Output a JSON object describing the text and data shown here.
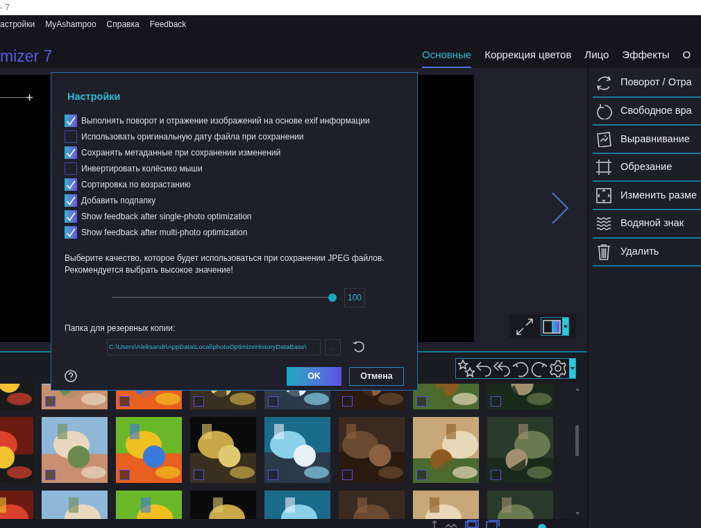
{
  "title_bar": {
    "title": "- 7"
  },
  "menu": [
    "астройки",
    "MyAshampoo",
    "Справка",
    "Feedback"
  ],
  "app_title": "mizer 7",
  "tabs": [
    {
      "label": "Основные",
      "selected": true
    },
    {
      "label": "Коррекция цветов",
      "selected": false
    },
    {
      "label": "Лицо",
      "selected": false
    },
    {
      "label": "Эффекты",
      "selected": false
    },
    {
      "label": "О",
      "selected": false
    }
  ],
  "tools": [
    {
      "kind": "rotate-flip",
      "label": "Поворот / Отра"
    },
    {
      "kind": "free-rotate",
      "label": "Свободное вра"
    },
    {
      "kind": "straighten",
      "label": "Выравнивание"
    },
    {
      "kind": "crop",
      "label": "Обрезание"
    },
    {
      "kind": "resize",
      "label": "Изменить разме"
    },
    {
      "kind": "watermark",
      "label": "Водяной знак"
    },
    {
      "kind": "delete",
      "label": "Удалить"
    }
  ],
  "dialog": {
    "title": "Настройки",
    "options": [
      {
        "label": "Выполнять поворот и отражение изображений на основе exif информации",
        "checked": true
      },
      {
        "label": "Использовать оригинальную дату файла при сохранении",
        "checked": false
      },
      {
        "label": "Сохранять метаданные при сохранении изменений",
        "checked": true
      },
      {
        "label": "Инвертировать колёсико мыши",
        "checked": false
      },
      {
        "label": "Сортировка по возрастанию",
        "checked": true
      },
      {
        "label": "Добавить подпапку",
        "checked": true
      },
      {
        "label": "Show feedback after single-photo optimization",
        "checked": true
      },
      {
        "label": "Show feedback after multi-photo optimization",
        "checked": true
      }
    ],
    "quality_note": [
      "Выберите качество, которое будет использоваться при сохранении JPEG файлов.",
      "Рекомендуется выбрать высокое значение!"
    ],
    "quality": {
      "level": 1,
      "value": "100"
    },
    "backup_label": "Папка для резервных копии:",
    "backup_path": "C:\\Users\\Aleksandr\\AppData\\Local\\photoOptimizeHistoryDataBase\\",
    "browse": "...",
    "ok": "OK",
    "cancel": "Отмена"
  },
  "thumbnails": [
    {
      "kind": "picture"
    },
    {
      "kind": "picture",
      "checked": false
    },
    {
      "kind": "picture",
      "checked": false
    },
    {
      "kind": "picture",
      "checked": false
    },
    {
      "kind": "picture",
      "checked": false
    },
    {
      "kind": "picture",
      "checked": false
    },
    {
      "kind": "picture",
      "checked": false
    },
    {
      "kind": "picture",
      "checked": false
    },
    {
      "kind": "picture"
    },
    {
      "kind": "picture",
      "checked": false
    },
    {
      "kind": "picture",
      "checked": false
    },
    {
      "kind": "picture",
      "checked": false
    },
    {
      "kind": "picture",
      "checked": false
    },
    {
      "kind": "picture",
      "checked": false
    },
    {
      "kind": "picture",
      "checked": false
    },
    {
      "kind": "picture",
      "checked": false
    },
    {
      "kind": "picture"
    },
    {
      "kind": "picture"
    },
    {
      "kind": "picture"
    },
    {
      "kind": "picture"
    },
    {
      "kind": "picture"
    },
    {
      "kind": "picture"
    },
    {
      "kind": "picture"
    },
    {
      "kind": "picture"
    }
  ]
}
